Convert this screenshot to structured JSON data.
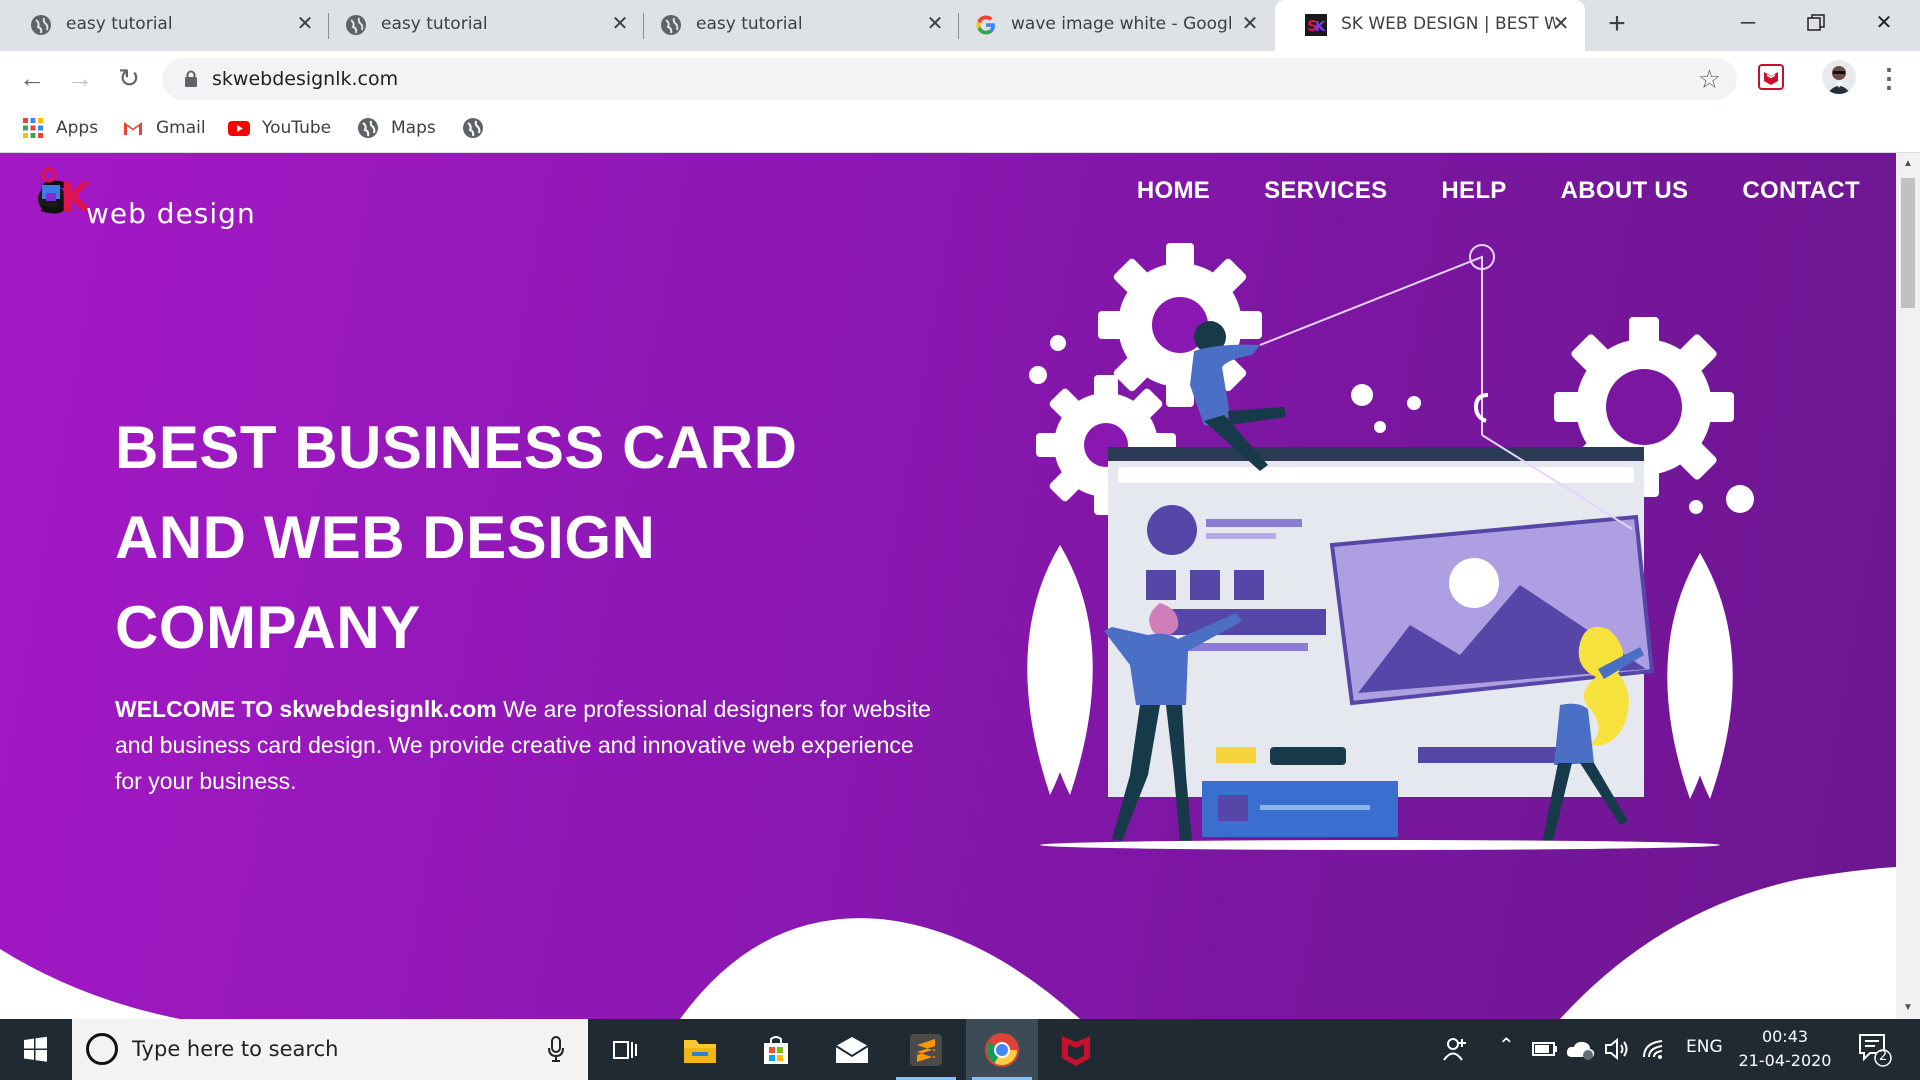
{
  "tabs": [
    {
      "title": "easy tutorial",
      "icon": "globe-icon"
    },
    {
      "title": "easy tutorial",
      "icon": "globe-icon"
    },
    {
      "title": "easy tutorial",
      "icon": "globe-icon"
    },
    {
      "title": "wave image white - Google",
      "icon": "google-icon"
    },
    {
      "title": "SK WEB DESIGN | BEST WE",
      "icon": "sk-favicon-icon",
      "active": true
    }
  ],
  "omnibox": {
    "url": "skwebdesignlk.com"
  },
  "bookmarks": [
    {
      "label": "Apps",
      "icon": "apps-grid-icon"
    },
    {
      "label": "Gmail",
      "icon": "gmail-icon"
    },
    {
      "label": "YouTube",
      "icon": "youtube-icon"
    },
    {
      "label": "Maps",
      "icon": "globe-icon"
    },
    {
      "label": "",
      "icon": "globe-icon"
    }
  ],
  "site": {
    "logo_text": "web design",
    "nav": [
      "HOME",
      "SERVICES",
      "HELP",
      "ABOUT US",
      "CONTACT"
    ],
    "headline": [
      "BEST BUSINESS CARD",
      "AND WEB DESIGN",
      "COMPANY"
    ],
    "intro_bold": "WELCOME TO skwebdesignlk.com",
    "intro_rest": " We are professional designers for website and business card design. We provide creative and innovative web experience for your business."
  },
  "taskbar": {
    "search_placeholder": "Type here to search",
    "language": "ENG",
    "time": "00:43",
    "date": "21-04-2020",
    "notification_count": "2"
  },
  "colors": {
    "page_gradient_start": "#a418c6",
    "page_gradient_end": "#6c1690",
    "taskbar": "#1f2a33"
  }
}
